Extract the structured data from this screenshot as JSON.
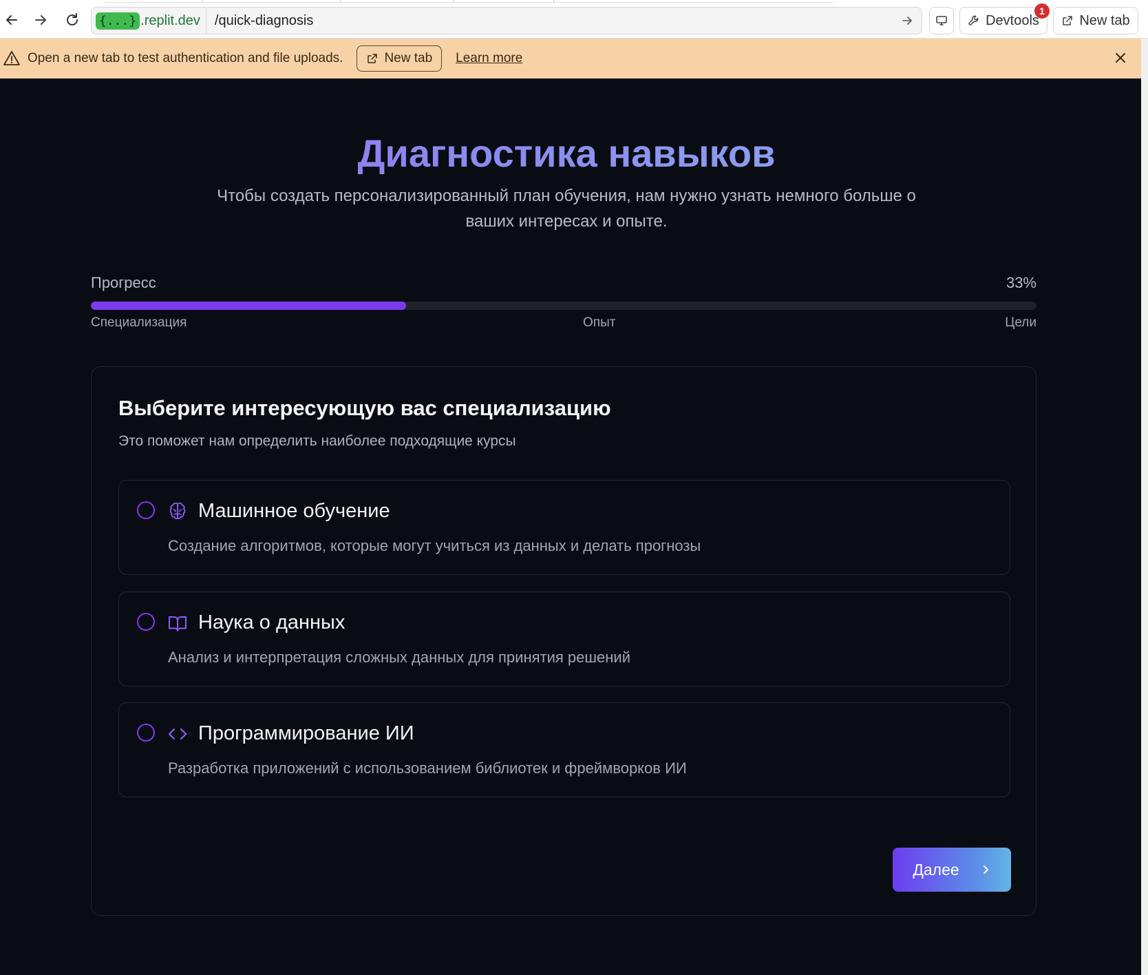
{
  "browser": {
    "url_badge": "{...}",
    "url_host": ".replit.dev",
    "url_path": "/quick-diagnosis",
    "devtools_label": "Devtools",
    "devtools_count": "1",
    "new_tab_label": "New tab"
  },
  "banner": {
    "message": "Open a new tab to test authentication and file uploads.",
    "new_tab_label": "New tab",
    "learn_more": "Learn more",
    "color": "#f8d2a7"
  },
  "hero": {
    "title": "Диагностика навыков",
    "subtitle": "Чтобы создать персонализированный план обучения, нам нужно узнать немного больше о ваших интересах и опыте."
  },
  "progress": {
    "label": "Прогресс",
    "percent_text": "33%",
    "value": 0.333,
    "steps": [
      "Специализация",
      "Опыт",
      "Цели"
    ],
    "accent": "#7c3aed"
  },
  "card": {
    "title": "Выберите интересующую вас специализацию",
    "description": "Это поможет нам определить наиболее подходящие курсы",
    "options": [
      {
        "icon": "brain-icon",
        "title": "Машинное обучение",
        "description": "Создание алгоритмов, которые могут учиться из данных и делать прогнозы",
        "selected": false
      },
      {
        "icon": "book-open-icon",
        "title": "Наука о данных",
        "description": "Анализ и интерпретация сложных данных для принятия решений",
        "selected": false
      },
      {
        "icon": "code-icon",
        "title": "Программирование ИИ",
        "description": "Разработка приложений с использованием библиотек и фреймворков ИИ",
        "selected": false
      }
    ],
    "next_label": "Далее"
  }
}
